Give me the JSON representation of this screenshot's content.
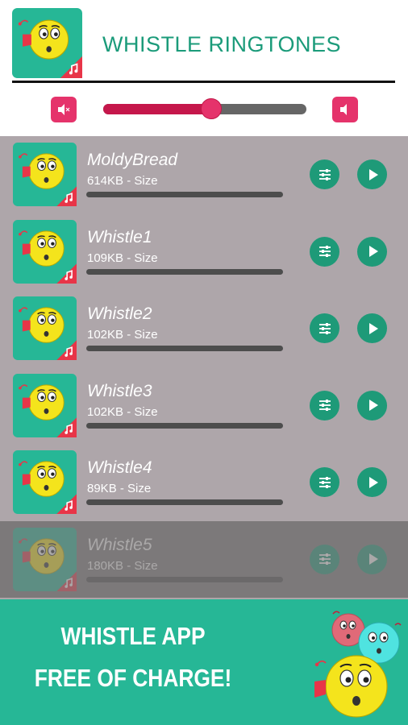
{
  "header": {
    "title": "WHISTLE RINGTONES",
    "app_icon": "whistle-emoji-icon"
  },
  "volume": {
    "level_percent": 53,
    "mute_icon": "volume-mute-icon",
    "max_icon": "volume-icon"
  },
  "ringtones": [
    {
      "name": "MoldyBread",
      "size": "614KB - Size"
    },
    {
      "name": "Whistle1",
      "size": "109KB - Size"
    },
    {
      "name": "Whistle2",
      "size": "102KB - Size"
    },
    {
      "name": "Whistle3",
      "size": "102KB - Size"
    },
    {
      "name": "Whistle4",
      "size": "89KB - Size"
    },
    {
      "name": "Whistle5",
      "size": "180KB - Size"
    }
  ],
  "banner": {
    "line1": "WHISTLE APP",
    "line2": "FREE OF CHARGE!"
  },
  "colors": {
    "accent": "#1b9b7a",
    "banner": "#26b796",
    "volume": "#e5336b",
    "list_bg": "#aea6aa"
  }
}
